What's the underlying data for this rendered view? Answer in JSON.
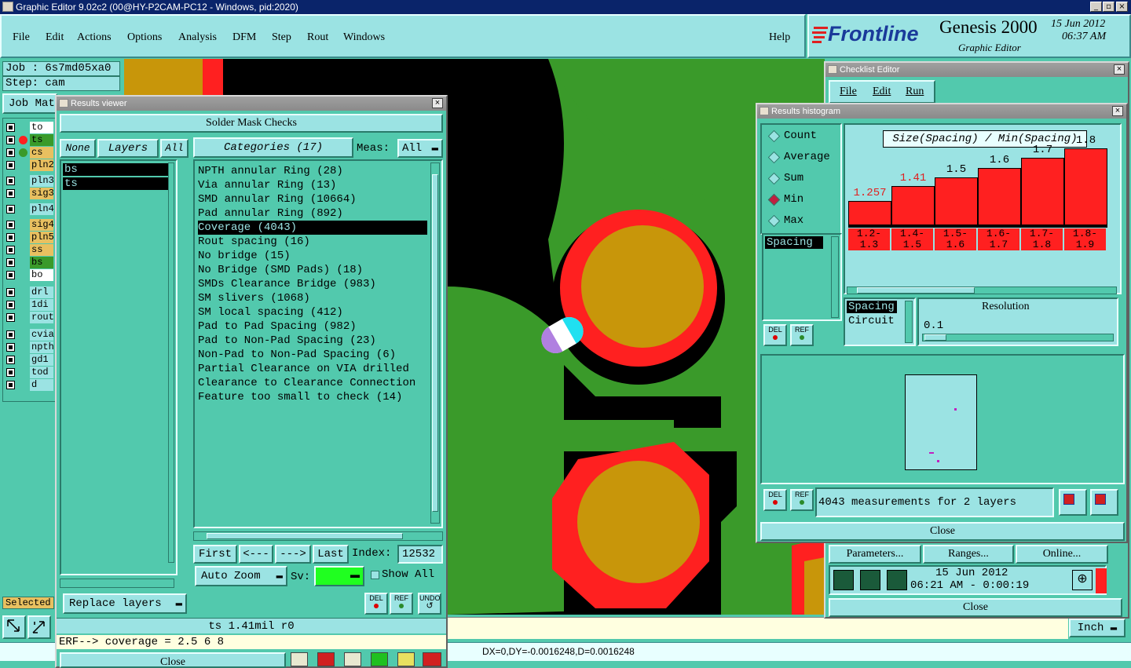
{
  "app": {
    "title": "Graphic Editor 9.02c2 (00@HY-P2CAM-PC12 - Windows, pid:2020)",
    "menu": [
      "File",
      "Edit",
      "Actions",
      "Options",
      "Analysis",
      "DFM",
      "Step",
      "Rout",
      "Windows"
    ],
    "help": "Help",
    "logo_text": "Frontline",
    "product": "Genesis 2000",
    "product_sub": "Graphic Editor",
    "date": "15 Jun 2012",
    "time": "06:37 AM"
  },
  "left_panel": {
    "job": "Job  : 6s7md05xa0",
    "step": "Step: cam",
    "job_matrix_label": "Job Mat",
    "layers": [
      {
        "name": "to",
        "color": "#ffffff"
      },
      {
        "name": "ts",
        "color": "#3a9a2a"
      },
      {
        "name": "cs",
        "color": "#e8c060"
      },
      {
        "name": "pln2",
        "color": "#e8c060"
      },
      {
        "name": "pln3",
        "color": "#9be3e3"
      },
      {
        "name": "sig3",
        "color": "#e8c060"
      },
      {
        "name": "pln4",
        "color": "#9be3e3"
      },
      {
        "name": "sig4",
        "color": "#e8c060"
      },
      {
        "name": "pln5",
        "color": "#e8c060"
      },
      {
        "name": "ss",
        "color": "#e8c060"
      },
      {
        "name": "bs",
        "color": "#3a9a2a"
      },
      {
        "name": "bo",
        "color": "#ffffff"
      },
      {
        "name": "drl",
        "color": "#9be3e3"
      },
      {
        "name": "1di",
        "color": "#9be3e3"
      },
      {
        "name": "rout",
        "color": "#9be3e3"
      },
      {
        "name": "cvia",
        "color": "#9be3e3"
      },
      {
        "name": "npth",
        "color": "#9be3e3"
      },
      {
        "name": "gd1",
        "color": "#9be3e3"
      },
      {
        "name": "tod",
        "color": "#9be3e3"
      },
      {
        "name": "d",
        "color": "#9be3e3"
      }
    ],
    "selected_label": "Selected"
  },
  "results_viewer": {
    "title": "Results viewer",
    "header": "Solder Mask Checks",
    "none_btn": "None",
    "layers_btn": "Layers",
    "all_btn": "All",
    "layer_list": [
      "bs",
      "ts"
    ],
    "categories_btn": "Categories (17)",
    "meas_label": "Meas:",
    "meas_value": "All",
    "categories": [
      "NPTH annular Ring (28)",
      "Via annular Ring (13)",
      "SMD annular Ring (10664)",
      "Pad annular Ring (892)",
      "Coverage (4043)",
      "Rout spacing (16)",
      "No bridge (15)",
      "No Bridge (SMD Pads) (18)",
      "SMDs Clearance Bridge (983)",
      "SM slivers (1068)",
      "SM local spacing (412)",
      "Pad to Pad Spacing (982)",
      "Pad to Non-Pad Spacing (23)",
      "Non-Pad to Non-Pad Spacing (6)",
      "Partial Clearance on VIA drilled",
      "Clearance to Clearance Connection",
      "Feature too small to check (14)"
    ],
    "selected_index": 4,
    "first_btn": "First",
    "prev_btn": "<---",
    "next_btn": "--->",
    "last_btn": "Last",
    "index_label": "Index:",
    "index_value": "12532",
    "auto_zoom": "Auto Zoom",
    "sv_label": "Sv:",
    "show_all": "Show All",
    "replace_layers": "Replace layers",
    "del_label": "DEL",
    "ref_label": "REF",
    "undo_label": "UNDO",
    "status": "ts 1.41mil  r0",
    "erf_line": "ERF--> coverage = 2.5 6 8",
    "close": "Close"
  },
  "checklist_editor": {
    "title": "Checklist Editor",
    "menu": [
      "File",
      "Edit",
      "Run"
    ],
    "parameters": "Parameters...",
    "ranges": "Ranges...",
    "online": "Online...",
    "date": "15 Jun 2012",
    "time_line": "06:21 AM - 0:00:19",
    "close": "Close"
  },
  "histogram": {
    "title": "Results histogram",
    "modes": [
      "Count",
      "Average",
      "Sum",
      "Min",
      "Max"
    ],
    "selected_mode": "Min",
    "chart_title": "Size(Spacing) / Min(Spacing)",
    "attr_list": [
      "Spacing"
    ],
    "param_list": [
      "Spacing",
      "Circuit"
    ],
    "resolution_label": "Resolution",
    "resolution_value": "0.1",
    "summary": "4043 measurements for 2 layers",
    "close": "Close",
    "del_label": "DEL",
    "ref_label": "REF"
  },
  "chart_data": {
    "type": "bar",
    "title": "Size(Spacing) / Min(Spacing)",
    "categories": [
      "1.2-1.3",
      "1.4-1.5",
      "1.5-1.6",
      "1.6-1.7",
      "1.7-1.8",
      "1.8-1.9"
    ],
    "category_top": [
      "1.2-",
      "1.4-",
      "1.5-",
      "1.6-",
      "1.7-",
      "1.8-"
    ],
    "category_bottom": [
      "1.3",
      "1.5",
      "1.6",
      "1.7",
      "1.8",
      "1.9"
    ],
    "value_labels": [
      "1.257",
      "1.41",
      "1.5",
      "1.6",
      "1.7",
      "1.8"
    ],
    "values": [
      1.257,
      1.41,
      1.5,
      1.6,
      1.7,
      1.8
    ],
    "highlight": [
      true,
      true,
      false,
      false,
      false,
      false
    ],
    "bar_color": "#ff2020",
    "label_highlight_color": "#e02020"
  },
  "bottom": {
    "coords": "DX=0,DY=-0.0016248,D=0.0016248",
    "units": "Inch"
  },
  "colors": {
    "panel": "#52c9ad",
    "panel_light": "#9be3e3",
    "copper": "#3a9a2a",
    "mask": "#ff2020",
    "pad": "#c8960a"
  }
}
